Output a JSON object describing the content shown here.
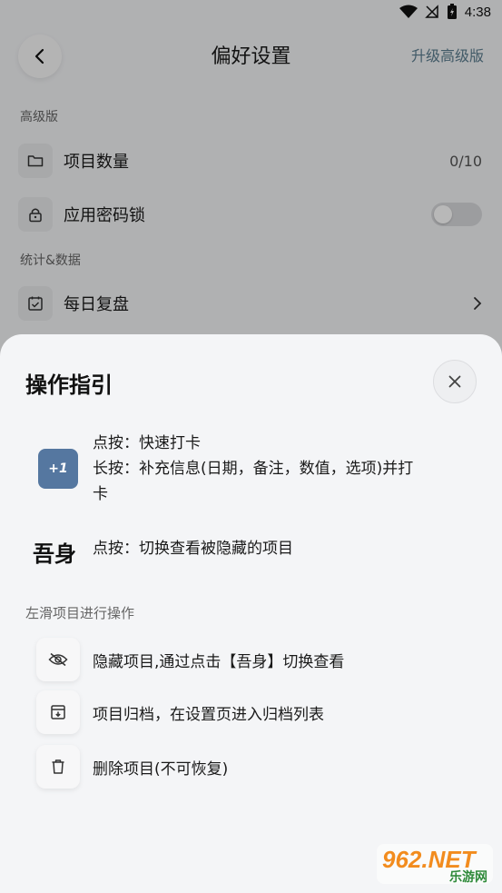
{
  "status_bar": {
    "time": "4:38"
  },
  "header": {
    "title": "偏好设置",
    "upgrade_label": "升级高级版"
  },
  "settings": {
    "premium_section": "高级版",
    "project_count_label": "项目数量",
    "project_count_value": "0/10",
    "app_lock_label": "应用密码锁",
    "stats_section": "统计&数据",
    "daily_review_label": "每日复盘"
  },
  "sheet": {
    "title": "操作指引",
    "badge_text": "+1",
    "tap_text": "点按：快速打卡",
    "long_press_line1": "长按：补充信息(日期，备注，数值，选项)并打",
    "long_press_line2": "卡",
    "hidden_demo": "吾身",
    "hidden_text": "点按：切换查看被隐藏的项目",
    "swipe_label": "左滑项目进行操作",
    "actions": [
      {
        "label": "隐藏项目,通过点击【吾身】切换查看",
        "icon": "eye-off-icon"
      },
      {
        "label": "项目归档，在设置页进入归档列表",
        "icon": "archive-icon"
      },
      {
        "label": "删除项目(不可恢复)",
        "icon": "trash-icon"
      }
    ]
  },
  "watermark": {
    "brand": "962.NET",
    "sub": "乐游网"
  },
  "colors": {
    "accent_link": "#5b7d8f",
    "badge_bg": "#5577a0",
    "sheet_bg": "#f4f5f7"
  }
}
